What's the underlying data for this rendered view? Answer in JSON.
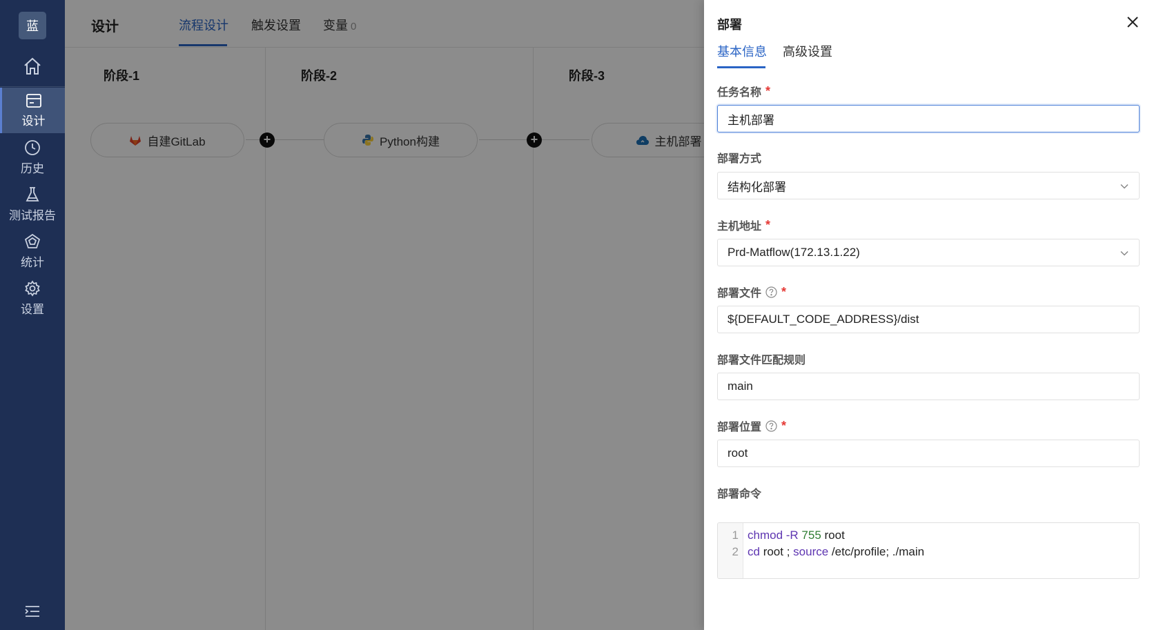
{
  "sidebar": {
    "logo": "蓝",
    "items": [
      {
        "label": "设计",
        "icon": "design-icon"
      },
      {
        "label": "历史",
        "icon": "clock-icon"
      },
      {
        "label": "测试报告",
        "icon": "flask-icon"
      },
      {
        "label": "统计",
        "icon": "stats-icon"
      },
      {
        "label": "设置",
        "icon": "gear-icon"
      }
    ]
  },
  "header": {
    "title": "设计",
    "tabs": [
      {
        "label": "流程设计"
      },
      {
        "label": "触发设置"
      },
      {
        "label": "变量",
        "count": "0"
      }
    ]
  },
  "pipeline": {
    "stages": [
      {
        "title": "阶段-1",
        "task": "自建GitLab",
        "task_icon": "gitlab-icon"
      },
      {
        "title": "阶段-2",
        "task": "Python构建",
        "task_icon": "python-icon"
      },
      {
        "title": "阶段-3",
        "task": "主机部署",
        "task_icon": "cloud-icon"
      }
    ]
  },
  "drawer": {
    "title": "部署",
    "tabs": [
      {
        "label": "基本信息"
      },
      {
        "label": "高级设置"
      }
    ],
    "fields": {
      "task_name": {
        "label": "任务名称",
        "value": "主机部署"
      },
      "deploy_mode": {
        "label": "部署方式",
        "value": "结构化部署"
      },
      "host": {
        "label": "主机地址",
        "value": "Prd-Matflow(172.13.1.22)"
      },
      "deploy_file": {
        "label": "部署文件",
        "value": "${DEFAULT_CODE_ADDRESS}/dist"
      },
      "match_rule": {
        "label": "部署文件匹配规则",
        "value": "main"
      },
      "location": {
        "label": "部署位置",
        "value": "root"
      },
      "command": {
        "label": "部署命令",
        "line_numbers": [
          "1",
          "2"
        ],
        "lines": [
          [
            {
              "t": "chmod",
              "c": "kw"
            },
            {
              "t": " -R ",
              "c": "kw"
            },
            {
              "t": "755",
              "c": "num"
            },
            {
              "t": " root",
              "c": ""
            }
          ],
          [
            {
              "t": "cd",
              "c": "kw"
            },
            {
              "t": " root ; ",
              "c": ""
            },
            {
              "t": "source",
              "c": "kw"
            },
            {
              "t": " /etc/profile; ./main",
              "c": ""
            }
          ]
        ]
      }
    }
  },
  "colors": {
    "sidebar_bg": "#1e2f54",
    "accent": "#2a64c5",
    "required": "#e53935"
  }
}
